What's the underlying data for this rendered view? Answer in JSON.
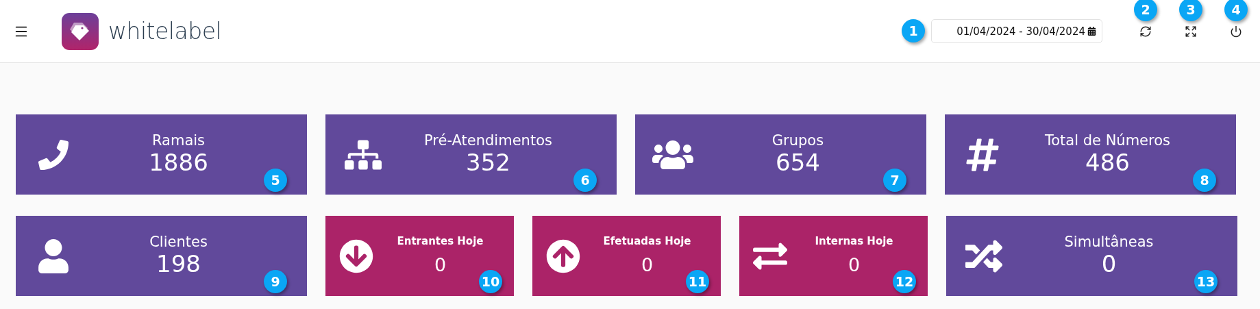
{
  "header": {
    "logo_text": "whitelabel",
    "date_range": "01/04/2024 - 30/04/2024",
    "date_badge": "1",
    "actions": [
      {
        "kind": "refresh",
        "badge": "2"
      },
      {
        "kind": "fullscreen",
        "badge": "3"
      },
      {
        "kind": "power",
        "badge": "4"
      }
    ]
  },
  "rows": [
    [
      {
        "kind": "large",
        "title": "Ramais",
        "value": "1886",
        "badge": "5",
        "color": "#61499b"
      },
      {
        "kind": "large",
        "title": "Pré-Atendimentos",
        "value": "352",
        "badge": "6",
        "color": "#61499b"
      },
      {
        "kind": "large",
        "title": "Grupos",
        "value": "654",
        "badge": "7",
        "color": "#61499b"
      },
      {
        "kind": "large",
        "title": "Total de Números",
        "value": "486",
        "badge": "8",
        "color": "#61499b"
      }
    ],
    [
      {
        "kind": "large",
        "title": "Clientes",
        "value": "198",
        "badge": "9",
        "color": "#61499b"
      },
      {
        "kind": "small",
        "title": "Entrantes Hoje",
        "value": "0",
        "badge": "10",
        "color": "#ab2368"
      },
      {
        "kind": "small",
        "title": "Efetuadas Hoje",
        "value": "0",
        "badge": "11",
        "color": "#ab2368"
      },
      {
        "kind": "small",
        "title": "Internas Hoje",
        "value": "0",
        "badge": "12",
        "color": "#ab2368"
      },
      {
        "kind": "large",
        "title": "Simultâneas",
        "value": "0",
        "badge": "13",
        "color": "#61499b"
      }
    ]
  ]
}
